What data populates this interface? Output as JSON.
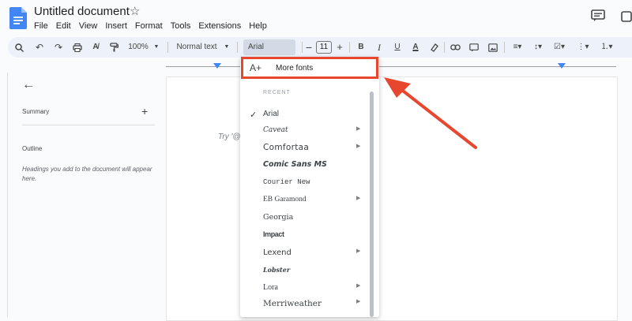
{
  "header": {
    "title": "Untitled document",
    "menu": [
      "File",
      "Edit",
      "View",
      "Insert",
      "Format",
      "Tools",
      "Extensions",
      "Help"
    ]
  },
  "toolbar": {
    "zoom": "100%",
    "style": "Normal text",
    "font": "Arial",
    "font_size": "11",
    "bold": "B",
    "italic": "I",
    "underline": "U",
    "text_color": "A"
  },
  "sidebar": {
    "summary": "Summary",
    "outline": "Outline",
    "outline_hint": "Headings you add to the document will appear here."
  },
  "document": {
    "hint": "Try '@"
  },
  "font_menu": {
    "more_fonts": "More fonts",
    "section_label": "RECENT",
    "selected": "Arial",
    "items": [
      "Arial",
      "Caveat",
      "Comfortaa",
      "Comic Sans MS",
      "Courier New",
      "EB Garamond",
      "Georgia",
      "Impact",
      "Lexend",
      "Lobster",
      "Lora",
      "Merriweather"
    ]
  },
  "colors": {
    "annotation": "#e8472f",
    "toolbar_bg": "#edf2fa",
    "doc_blue": "#4285f4"
  }
}
